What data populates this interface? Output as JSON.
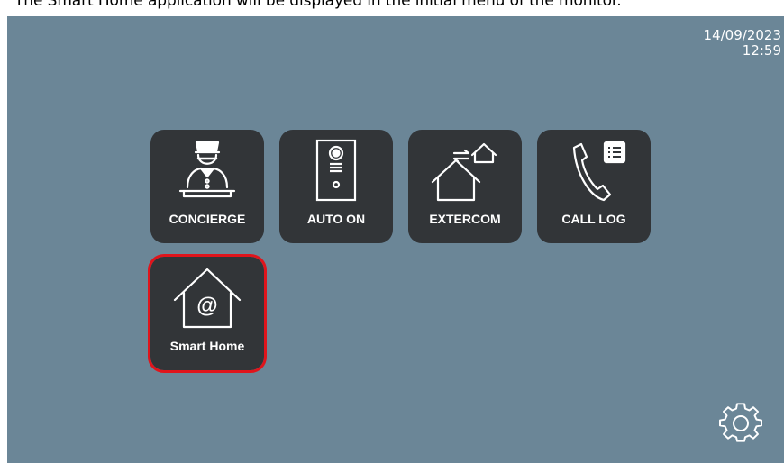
{
  "caption": {
    "text": "The Smart Home application will be displayed in the initial menu of the monitor."
  },
  "status": {
    "date": "14/09/2023",
    "time": "12:59"
  },
  "apps": [
    {
      "label": "CONCIERGE",
      "icon": "concierge-icon"
    },
    {
      "label": "AUTO ON",
      "icon": "door-panel-icon"
    },
    {
      "label": "EXTERCOM",
      "icon": "extercom-houses-icon"
    },
    {
      "label": "CALL LOG",
      "icon": "phone-log-icon"
    },
    {
      "label": "Smart Home",
      "icon": "smart-home-at-icon",
      "selected": true
    }
  ],
  "settings": {
    "icon": "gear-icon"
  },
  "colors": {
    "screen_bg": "#6b8697",
    "tile_bg": "#323538",
    "highlight": "#e0141b",
    "text": "#ffffff"
  }
}
